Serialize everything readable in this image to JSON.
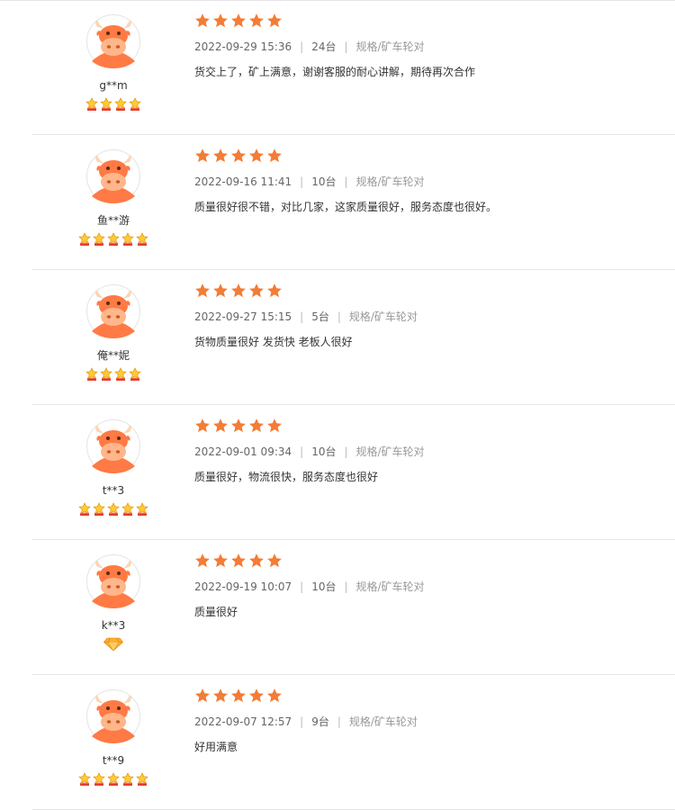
{
  "colors": {
    "star": "#f47c34",
    "avatar_bg": "#ff7a45",
    "avatar_face": "#ffb68a",
    "divider": "#e6e6e6"
  },
  "reviews": [
    {
      "user": "g**m",
      "badge": "crown",
      "badge_count": 4,
      "rating": 5,
      "date": "2022-09-29 15:36",
      "quantity": "24台",
      "spec": "规格/矿车轮对",
      "content": "货交上了，矿上满意，谢谢客服的耐心讲解，期待再次合作"
    },
    {
      "user": "鱼**游",
      "badge": "crown",
      "badge_count": 5,
      "rating": 5,
      "date": "2022-09-16 11:41",
      "quantity": "10台",
      "spec": "规格/矿车轮对",
      "content": "质量很好很不错，对比几家，这家质量很好，服务态度也很好。"
    },
    {
      "user": "俺**妮",
      "badge": "crown",
      "badge_count": 4,
      "rating": 5,
      "date": "2022-09-27 15:15",
      "quantity": "5台",
      "spec": "规格/矿车轮对",
      "content": "货物质量很好 发货快 老板人很好"
    },
    {
      "user": "t**3",
      "badge": "crown",
      "badge_count": 5,
      "rating": 5,
      "date": "2022-09-01 09:34",
      "quantity": "10台",
      "spec": "规格/矿车轮对",
      "content": "质量很好，物流很快，服务态度也很好"
    },
    {
      "user": "k**3",
      "badge": "diamond",
      "badge_count": 1,
      "rating": 5,
      "date": "2022-09-19 10:07",
      "quantity": "10台",
      "spec": "规格/矿车轮对",
      "content": "质量很好"
    },
    {
      "user": "t**9",
      "badge": "crown",
      "badge_count": 5,
      "rating": 5,
      "date": "2022-09-07 12:57",
      "quantity": "9台",
      "spec": "规格/矿车轮对",
      "content": "好用满意"
    }
  ]
}
